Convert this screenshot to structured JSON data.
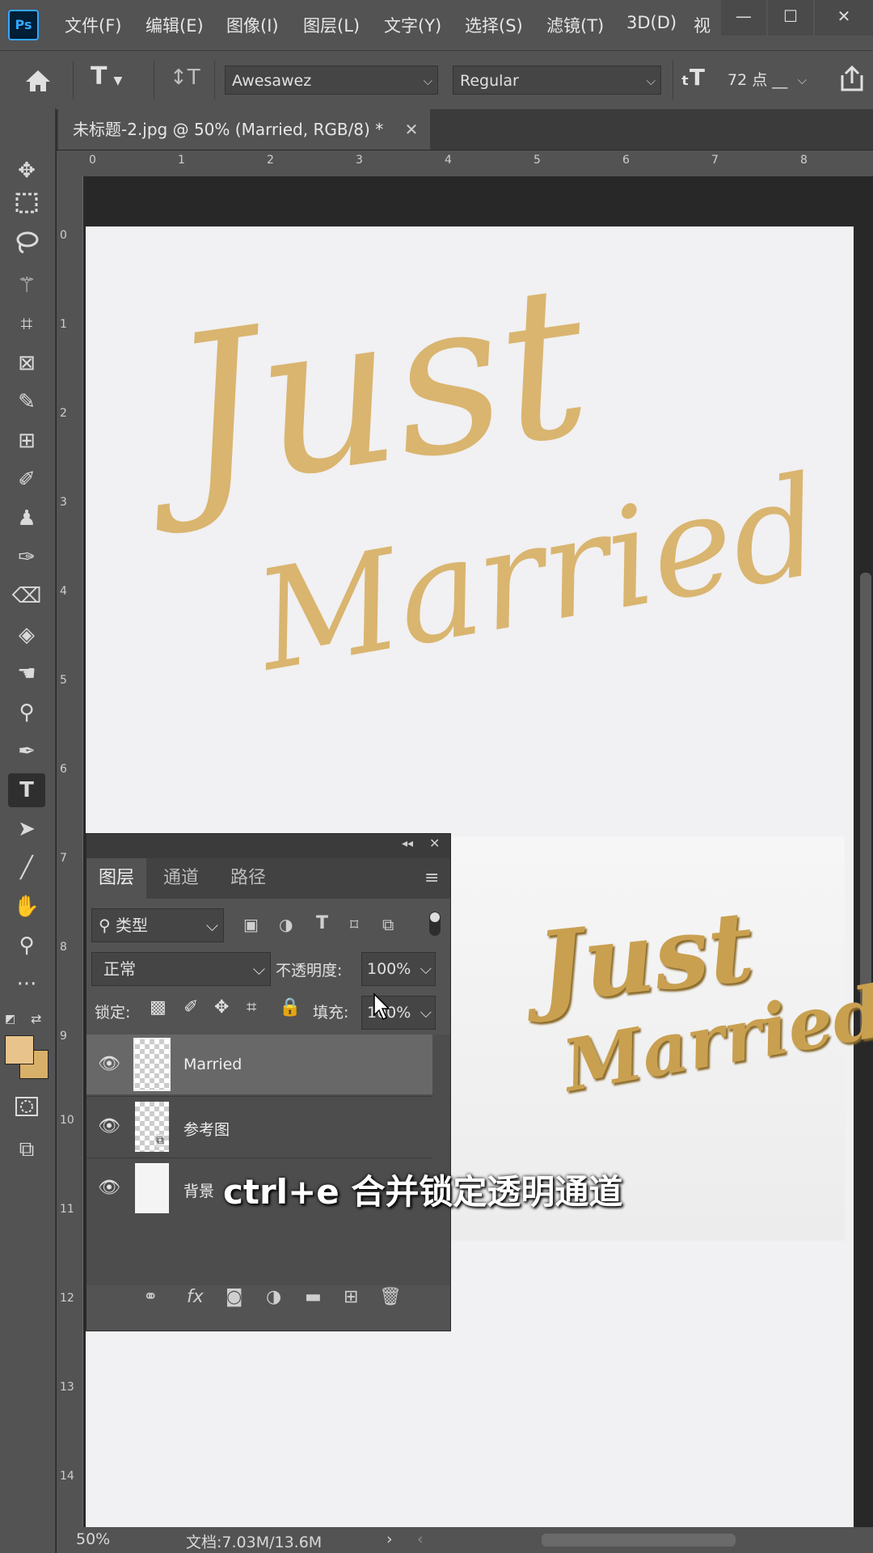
{
  "app": {
    "logo": "Ps"
  },
  "menu": [
    "文件(F)",
    "编辑(E)",
    "图像(I)",
    "图层(L)",
    "文字(Y)",
    "选择(S)",
    "滤镜(T)",
    "3D(D)",
    "视"
  ],
  "window_controls": {
    "minimize": "—",
    "maximize": "☐",
    "close": "✕"
  },
  "options_bar": {
    "text_tool_glyph": "T",
    "orient_glyph": "↕T",
    "font_family": "Awesawez",
    "font_style": "Regular",
    "size_glyph": "T",
    "font_size": "72 点",
    "font_size_suffix": "__"
  },
  "document_tab": {
    "title": "未标题-2.jpg @ 50% (Married, RGB/8) *",
    "close": "✕"
  },
  "ruler": {
    "horizontal": [
      "0",
      "1",
      "2",
      "3",
      "4",
      "5",
      "6",
      "7",
      "8"
    ],
    "vertical": [
      "0",
      "1",
      "2",
      "3",
      "4",
      "5",
      "6",
      "7",
      "8",
      "9",
      "10",
      "11",
      "12",
      "13",
      "14"
    ]
  },
  "artwork": {
    "line1": "Just",
    "line2": "Married",
    "color": "#d9b56f"
  },
  "photo_text": {
    "line1": "Just",
    "line2": "Married"
  },
  "colors": {
    "foreground": "#e8c48c",
    "background": "#d9b06a",
    "accent": "#31a8ff"
  },
  "layers_panel": {
    "tabs": [
      "图层",
      "通道",
      "路径"
    ],
    "filter_kind": "类型",
    "blend_mode": "正常",
    "opacity_label": "不透明度:",
    "opacity_value": "100%",
    "lock_label": "锁定:",
    "fill_label": "填充:",
    "fill_value": "100%",
    "layers": [
      {
        "name": "Married",
        "selected": true
      },
      {
        "name": "参考图",
        "selected": false
      },
      {
        "name": "背景",
        "selected": false
      }
    ]
  },
  "status": {
    "zoom": "50%",
    "doc_info": "文档:7.03M/13.6M"
  },
  "subtitle": "ctrl+e 合并锁定透明通道"
}
